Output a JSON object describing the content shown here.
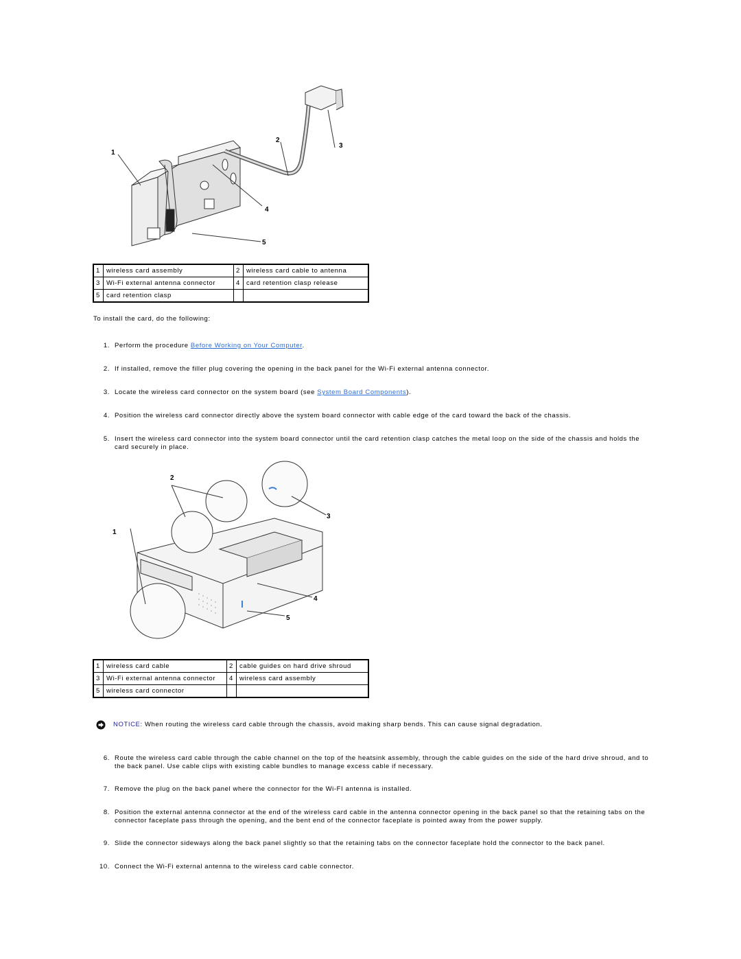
{
  "figure1": {
    "callouts": [
      "1",
      "2",
      "3",
      "4",
      "5"
    ]
  },
  "table1": {
    "rows": [
      [
        {
          "num": "1",
          "label": "wireless card assembly"
        },
        {
          "num": "2",
          "label": "wireless card cable to antenna"
        }
      ],
      [
        {
          "num": "3",
          "label": "Wi-Fi external antenna connector"
        },
        {
          "num": "4",
          "label": "card retention clasp release"
        }
      ],
      [
        {
          "num": "5",
          "label": "card retention clasp"
        },
        {
          "num": "",
          "label": ""
        }
      ]
    ]
  },
  "intro": "To install the card, do the following:",
  "steps": [
    {
      "n": "1.",
      "pre": "Perform the procedure ",
      "link": "Before Working on Your Computer",
      "post": "."
    },
    {
      "n": "2.",
      "text": "If installed, remove the filler plug covering the opening in the back panel for the Wi-Fi external antenna connector."
    },
    {
      "n": "3.",
      "pre": "Locate the wireless card connector on the system board (see ",
      "link": "System Board Components",
      "post": ")."
    },
    {
      "n": "4.",
      "text": "Position the wireless card connector directly above the system board connector with cable edge of the card toward the back of the chassis."
    },
    {
      "n": "5.",
      "text": "Insert the wireless card connector into the system board connector until the card retention clasp catches the metal loop on the side of the chassis and holds the card securely in place."
    },
    {
      "n": "6.",
      "text": "Route the wireless card cable through the cable channel on the top of the heatsink assembly, through the cable guides on the side of the hard drive shroud, and to the back panel. Use cable clips with existing cable bundles to manage excess cable if necessary."
    },
    {
      "n": "7.",
      "text": "Remove the plug on the back panel where the connector for the Wi-FI antenna is installed."
    },
    {
      "n": "8.",
      "text": "Position the external antenna connector at the end of the wireless card cable in the antenna connector opening in the back panel so that the retaining tabs on the connector faceplate pass through the opening, and the bent end of the connector faceplate is pointed away from the power supply."
    },
    {
      "n": "9.",
      "text": "Slide the connector sideways along the back panel slightly so that the retaining tabs on the connector faceplate hold the connector to the back panel."
    },
    {
      "n": "10.",
      "text": "Connect the Wi-Fi external antenna to the wireless card cable connector."
    }
  ],
  "figure2": {
    "callouts": [
      "1",
      "2",
      "3",
      "4",
      "5"
    ]
  },
  "table2": {
    "rows": [
      [
        {
          "num": "1",
          "label": "wireless card cable"
        },
        {
          "num": "2",
          "label": "cable guides on hard drive shroud"
        }
      ],
      [
        {
          "num": "3",
          "label": "Wi-Fi external antenna connector"
        },
        {
          "num": "4",
          "label": "wireless card assembly"
        }
      ],
      [
        {
          "num": "5",
          "label": "wireless card connector"
        },
        {
          "num": "",
          "label": ""
        }
      ]
    ]
  },
  "notice": {
    "label": "NOTICE:",
    "text": " When routing the wireless card cable through the chassis, avoid making sharp bends. This can cause signal degradation."
  },
  "colors": {
    "link": "#2a6bd6",
    "notice_label": "#1f1f99"
  }
}
